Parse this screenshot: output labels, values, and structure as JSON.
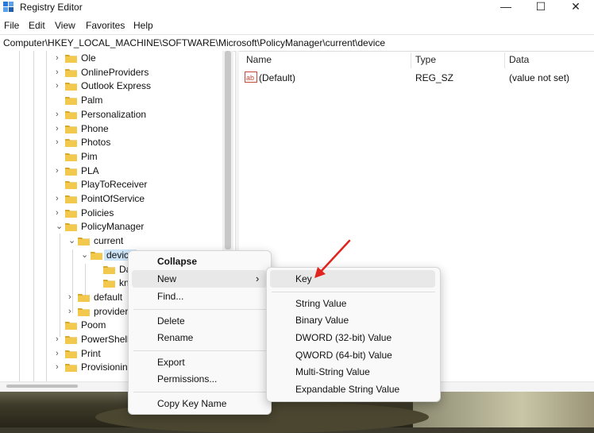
{
  "window": {
    "title": "Registry Editor",
    "controls": {
      "minimize": "—",
      "maximize": "☐",
      "close": "✕"
    }
  },
  "menubar": [
    "File",
    "Edit",
    "View",
    "Favorites",
    "Help"
  ],
  "address": "Computer\\HKEY_LOCAL_MACHINE\\SOFTWARE\\Microsoft\\PolicyManager\\current\\device",
  "tree": [
    {
      "label": "Ole",
      "chevron": "›"
    },
    {
      "label": "OnlineProviders",
      "chevron": "›"
    },
    {
      "label": "Outlook Express",
      "chevron": "›"
    },
    {
      "label": "Palm",
      "chevron": ""
    },
    {
      "label": "Personalization",
      "chevron": "›"
    },
    {
      "label": "Phone",
      "chevron": "›"
    },
    {
      "label": "Photos",
      "chevron": "›"
    },
    {
      "label": "Pim",
      "chevron": ""
    },
    {
      "label": "PLA",
      "chevron": "›"
    },
    {
      "label": "PlayToReceiver",
      "chevron": ""
    },
    {
      "label": "PointOfService",
      "chevron": "›"
    },
    {
      "label": "Policies",
      "chevron": "›"
    },
    {
      "label": "PolicyManager",
      "chevron": "⌄"
    },
    {
      "label": "current",
      "chevron": "⌄"
    },
    {
      "label": "device",
      "chevron": "⌄"
    },
    {
      "label": "Da",
      "chevron": ""
    },
    {
      "label": "kn",
      "chevron": ""
    },
    {
      "label": "default",
      "chevron": "›"
    },
    {
      "label": "provider",
      "chevron": "›"
    },
    {
      "label": "Poom",
      "chevron": ""
    },
    {
      "label": "PowerShell",
      "chevron": "›"
    },
    {
      "label": "Print",
      "chevron": "›"
    },
    {
      "label": "Provisionin",
      "chevron": "›"
    }
  ],
  "list": {
    "columns": {
      "name": "Name",
      "type": "Type",
      "data": "Data"
    },
    "rows": [
      {
        "icon": "ab",
        "name": "(Default)",
        "type": "REG_SZ",
        "data": "(value not set)"
      }
    ]
  },
  "context_menu": {
    "collapse": "Collapse",
    "new": "New",
    "new_arrow": "›",
    "find": "Find...",
    "delete": "Delete",
    "rename": "Rename",
    "export": "Export",
    "permissions": "Permissions...",
    "copy_key_name": "Copy Key Name"
  },
  "submenu": {
    "key": "Key",
    "string_value": "String Value",
    "binary_value": "Binary Value",
    "dword_value": "DWORD (32-bit) Value",
    "qword_value": "QWORD (64-bit) Value",
    "multi_string_value": "Multi-String Value",
    "expandable_string_value": "Expandable String Value"
  },
  "colors": {
    "folder": "#f2c94c",
    "folder_dark": "#d9a92c",
    "selection": "#cce4f7",
    "arrow": "#e0231d"
  }
}
